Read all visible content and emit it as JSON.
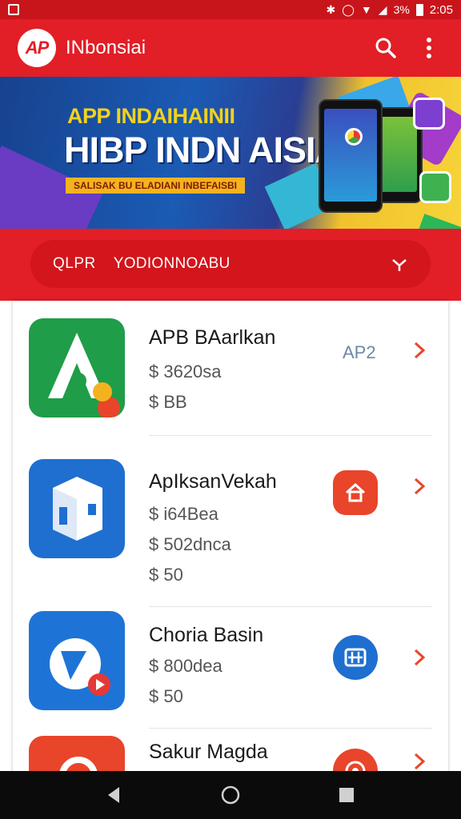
{
  "status_bar": {
    "battery_text": "3%",
    "time": "2:05"
  },
  "app_bar": {
    "logo_text": "AP",
    "title": "INbonsiai",
    "search_icon": "search-icon",
    "menu_icon": "more-vert-icon"
  },
  "banner": {
    "kicker": "APP INDAIHAINII",
    "headline": "HIBP INDN AISIAI",
    "strip": "SALISAK BU ELADIANI INBEFAISBI"
  },
  "filter": {
    "prefix": "QLPR",
    "value": "YODIONNOABU",
    "dropdown_icon": "chevron-down-icon"
  },
  "apps": [
    {
      "name": "APB BAarlkan",
      "lines": [
        "$ 3620sa",
        "$ BB"
      ],
      "tag": "AP2",
      "icon_color": "#1f9d48"
    },
    {
      "name": "ApIksanVekah",
      "lines": [
        "$ i64Bea",
        "$ 502dnca",
        "$ 50"
      ],
      "badge_icon": "home-icon",
      "icon_color": "#1e6fd0"
    },
    {
      "name": "Choria Basin",
      "lines": [
        "$ 800dea",
        "$ 50"
      ],
      "badge_icon": "grid-icon",
      "icon_color": "#1e74d6"
    },
    {
      "name": "Sakur Magda",
      "lines": [],
      "badge_icon": "target-icon",
      "icon_color": "#e8452b"
    }
  ],
  "colors": {
    "primary": "#e21e26",
    "accent_badge": "#e8452b",
    "blue_badge": "#1e6fd0"
  }
}
